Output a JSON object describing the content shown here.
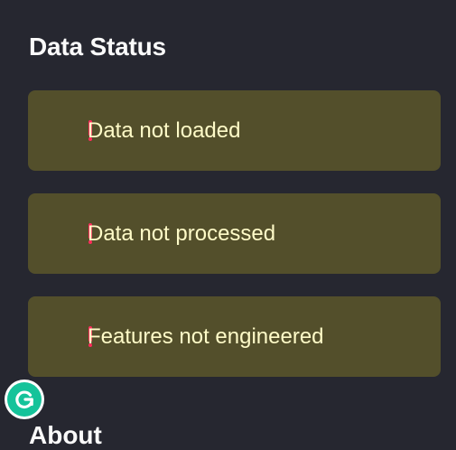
{
  "sidebar": {
    "section_title": "Data Status",
    "status_items": [
      {
        "label": "Data not loaded",
        "icon": "exclamation-icon"
      },
      {
        "label": "Data not processed",
        "icon": "exclamation-icon"
      },
      {
        "label": "Features not engineered",
        "icon": "exclamation-icon"
      }
    ],
    "next_section_title": "About"
  },
  "colors": {
    "background": "#262730",
    "warning_card": "#534f2b",
    "warning_text": "#fffbc8",
    "warning_icon": "#ff2b5b",
    "grammarly_green": "#15c39a"
  },
  "overlay": {
    "icon": "grammarly-icon"
  }
}
